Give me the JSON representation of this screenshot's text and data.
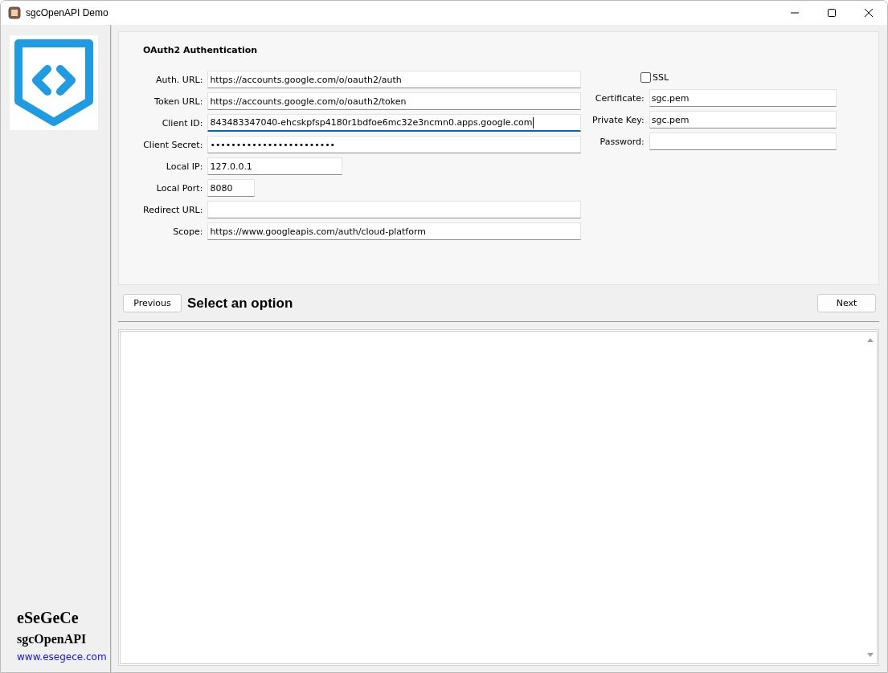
{
  "window": {
    "title": "sgcOpenAPI Demo"
  },
  "sidebar": {
    "company": "eSeGeCe",
    "product": "sgcOpenAPI",
    "link": "www.esegece.com"
  },
  "form": {
    "title": "OAuth2 Authentication",
    "fields": [
      {
        "label": "Auth. URL:",
        "value": "https://accounts.google.com/o/oauth2/auth",
        "kind": "long",
        "focused": false
      },
      {
        "label": "Token URL:",
        "value": "https://accounts.google.com/o/oauth2/token",
        "kind": "long",
        "focused": false
      },
      {
        "label": "Client ID:",
        "value": "843483347040-ehcskpfsp4180r1bdfoe6mc32e3ncmn0.apps.google.com",
        "kind": "long",
        "focused": true
      },
      {
        "label": "Client Secret:",
        "value": "••••••••••••••••••••••••",
        "kind": "long",
        "focused": false
      },
      {
        "label": "Local IP:",
        "value": "127.0.0.1",
        "kind": "medium",
        "focused": false
      },
      {
        "label": "Local Port:",
        "value": "8080",
        "kind": "short",
        "focused": false
      },
      {
        "label": "Redirect URL:",
        "kind": "long",
        "focused": false
      },
      {
        "label": "Scope:",
        "value": "https://www.googleapis.com/auth/cloud-platform",
        "kind": "long",
        "focused": false
      }
    ],
    "ssl": {
      "label": "SSL",
      "checked": false
    },
    "ssl_fields": [
      {
        "label": "Certificate:",
        "value": "sgc.pem"
      },
      {
        "label": "Private Key:",
        "value": "sgc.pem"
      },
      {
        "label": "Password:"
      }
    ]
  },
  "nav": {
    "previous": "Previous",
    "status": "Select an option",
    "next": "Next"
  }
}
